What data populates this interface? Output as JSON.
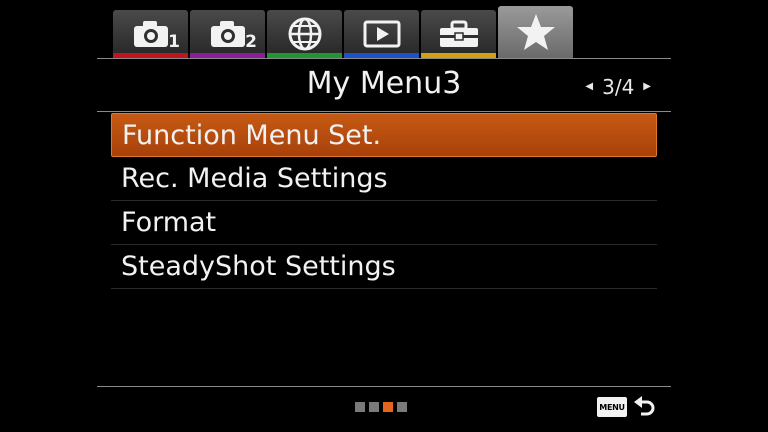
{
  "tabs": [
    {
      "name": "camera-settings-1",
      "icon": "camera-icon",
      "sub": "1",
      "color": "#c0141e",
      "active": false
    },
    {
      "name": "camera-settings-2",
      "icon": "camera-icon",
      "sub": "2",
      "color": "#8a1e96",
      "active": false
    },
    {
      "name": "network",
      "icon": "globe-icon",
      "sub": "",
      "color": "#1e9632",
      "active": false
    },
    {
      "name": "playback",
      "icon": "playback-icon",
      "sub": "",
      "color": "#1e50c8",
      "active": false
    },
    {
      "name": "setup",
      "icon": "toolbox-icon",
      "sub": "",
      "color": "#d2a014",
      "active": false
    },
    {
      "name": "my-menu",
      "icon": "star-icon",
      "sub": "",
      "color": "#7a7a7a",
      "active": true
    }
  ],
  "header": {
    "title": "My Menu3",
    "page": "3/4"
  },
  "menu": {
    "items": [
      {
        "label": "Function Menu Set.",
        "selected": true
      },
      {
        "label": "Rec. Media Settings",
        "selected": false
      },
      {
        "label": "Format",
        "selected": false
      },
      {
        "label": "SteadyShot Settings",
        "selected": false
      }
    ]
  },
  "footer": {
    "page_count": 4,
    "current_page": 3,
    "menu_label": "MENU",
    "accent": "#e5651d"
  }
}
